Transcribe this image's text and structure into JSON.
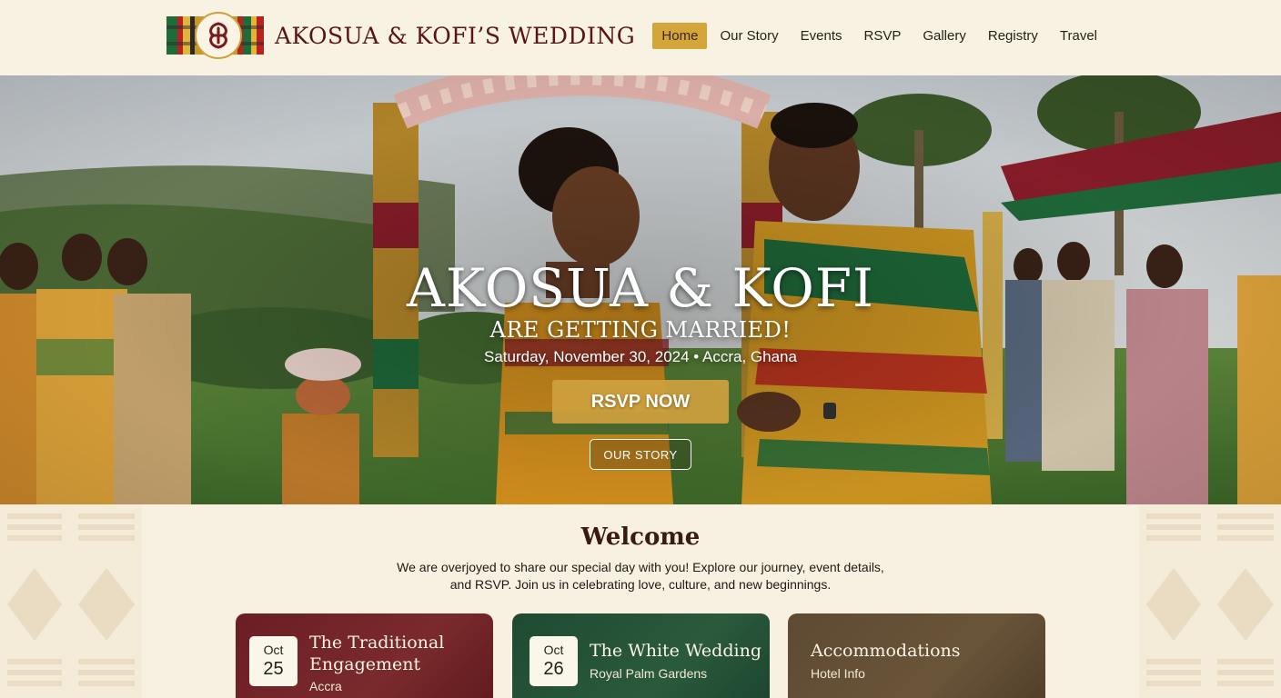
{
  "header": {
    "site_title": "AKOSUA & KOFI’S WEDDING",
    "nav": [
      {
        "label": "Home",
        "active": true
      },
      {
        "label": "Our Story"
      },
      {
        "label": "Events"
      },
      {
        "label": "RSVP"
      },
      {
        "label": "Gallery"
      },
      {
        "label": "Registry"
      },
      {
        "label": "Travel"
      }
    ]
  },
  "hero": {
    "names": "AKOSUA & KOFI",
    "subtitle": "ARE GETTING MARRIED!",
    "date_line": "Saturday, November 30, 2024 • Accra, Ghana",
    "rsvp_button": "RSVP NOW",
    "story_button": "OUR STORY"
  },
  "welcome": {
    "title": "Welcome",
    "text": "We are overjoyed to share our special day with you! Explore our journey, event details, and RSVP. Join us in celebrating love, culture, and new beginnings."
  },
  "cards": [
    {
      "month": "Oct",
      "day": "25",
      "title": "The Traditional Engagement",
      "subtitle": "Accra"
    },
    {
      "month": "Oct",
      "day": "26",
      "title": "The White Wedding",
      "subtitle": "Royal Palm Gardens"
    },
    {
      "title": "Accommodations",
      "subtitle": "Hotel Info"
    }
  ],
  "colors": {
    "maroon": "#5a1418",
    "gold": "#d4a63a",
    "green": "#1f4a32",
    "cream": "#f8f1e2"
  }
}
